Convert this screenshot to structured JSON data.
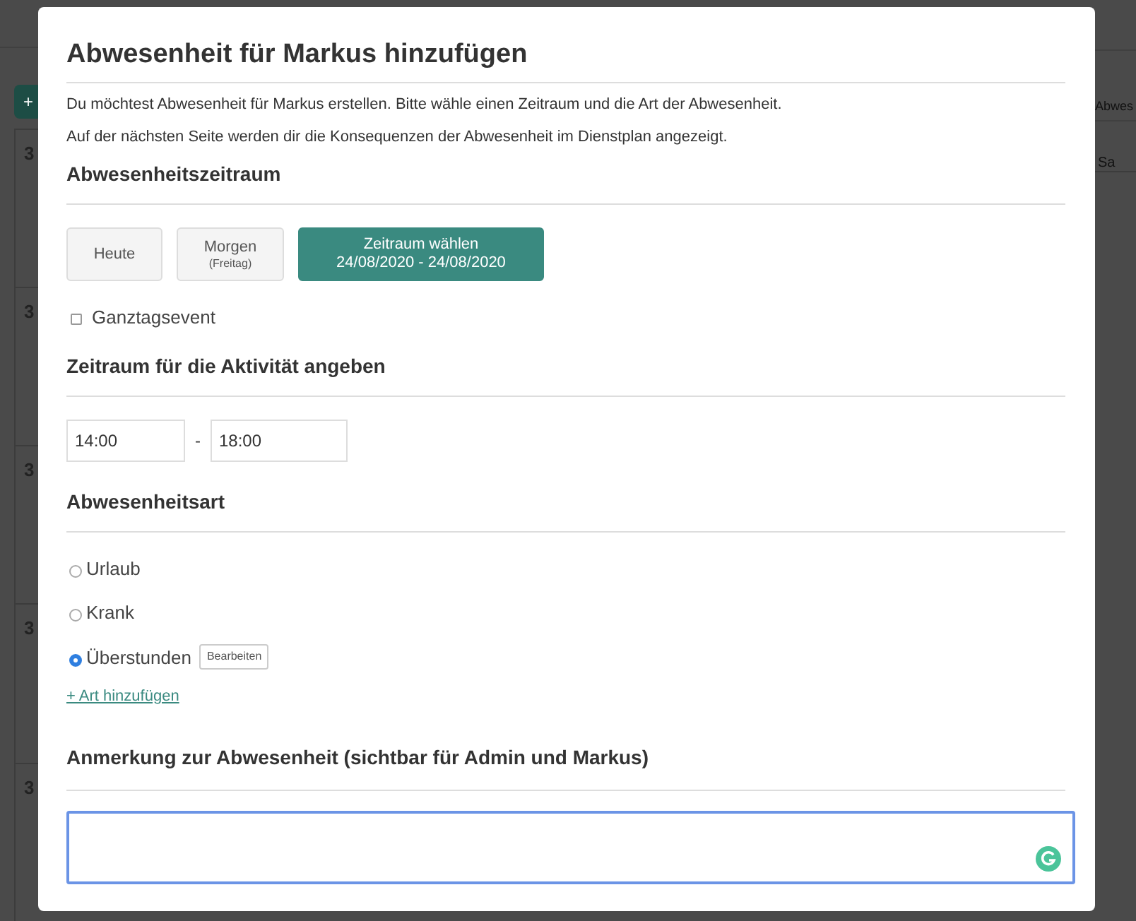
{
  "background": {
    "add_button": "+",
    "week_numbers": [
      "3",
      "3",
      "3",
      "3",
      "3"
    ],
    "side_button": "Abwes",
    "day_label": "Sa"
  },
  "dialog": {
    "title": "Abwesenheit für Markus hinzufügen",
    "intro": [
      "Du möchtest Abwesenheit für Markus erstellen. Bitte wähle einen Zeitraum und die Art der Abwesenheit.",
      "Auf der nächsten Seite werden dir die Konsequenzen der Abwesenheit im Dienstplan angezeigt."
    ],
    "period": {
      "heading": "Abwesenheitszeitraum",
      "options": [
        {
          "label": "Heute",
          "selected": false
        },
        {
          "label": "Morgen",
          "sublabel": "(Freitag)",
          "selected": false
        },
        {
          "label": "Zeitraum wählen",
          "sublabel": "24/08/2020 - 24/08/2020",
          "selected": true
        }
      ],
      "all_day": {
        "label": "Ganztagsevent",
        "checked": false
      }
    },
    "time": {
      "heading": "Zeitraum für die Aktivität angeben",
      "from": "14:00",
      "separator": "-",
      "to": "18:00"
    },
    "type": {
      "heading": "Abwesenheitsart",
      "options": [
        {
          "label": "Urlaub",
          "selected": false
        },
        {
          "label": "Krank",
          "selected": false
        },
        {
          "label": "Überstunden",
          "selected": true,
          "action": "Bearbeiten"
        }
      ],
      "add_link": "+ Art hinzufügen"
    },
    "note": {
      "heading": "Anmerkung zur Abwesenheit (sichtbar für Admin und Markus)",
      "focused": true
    }
  }
}
